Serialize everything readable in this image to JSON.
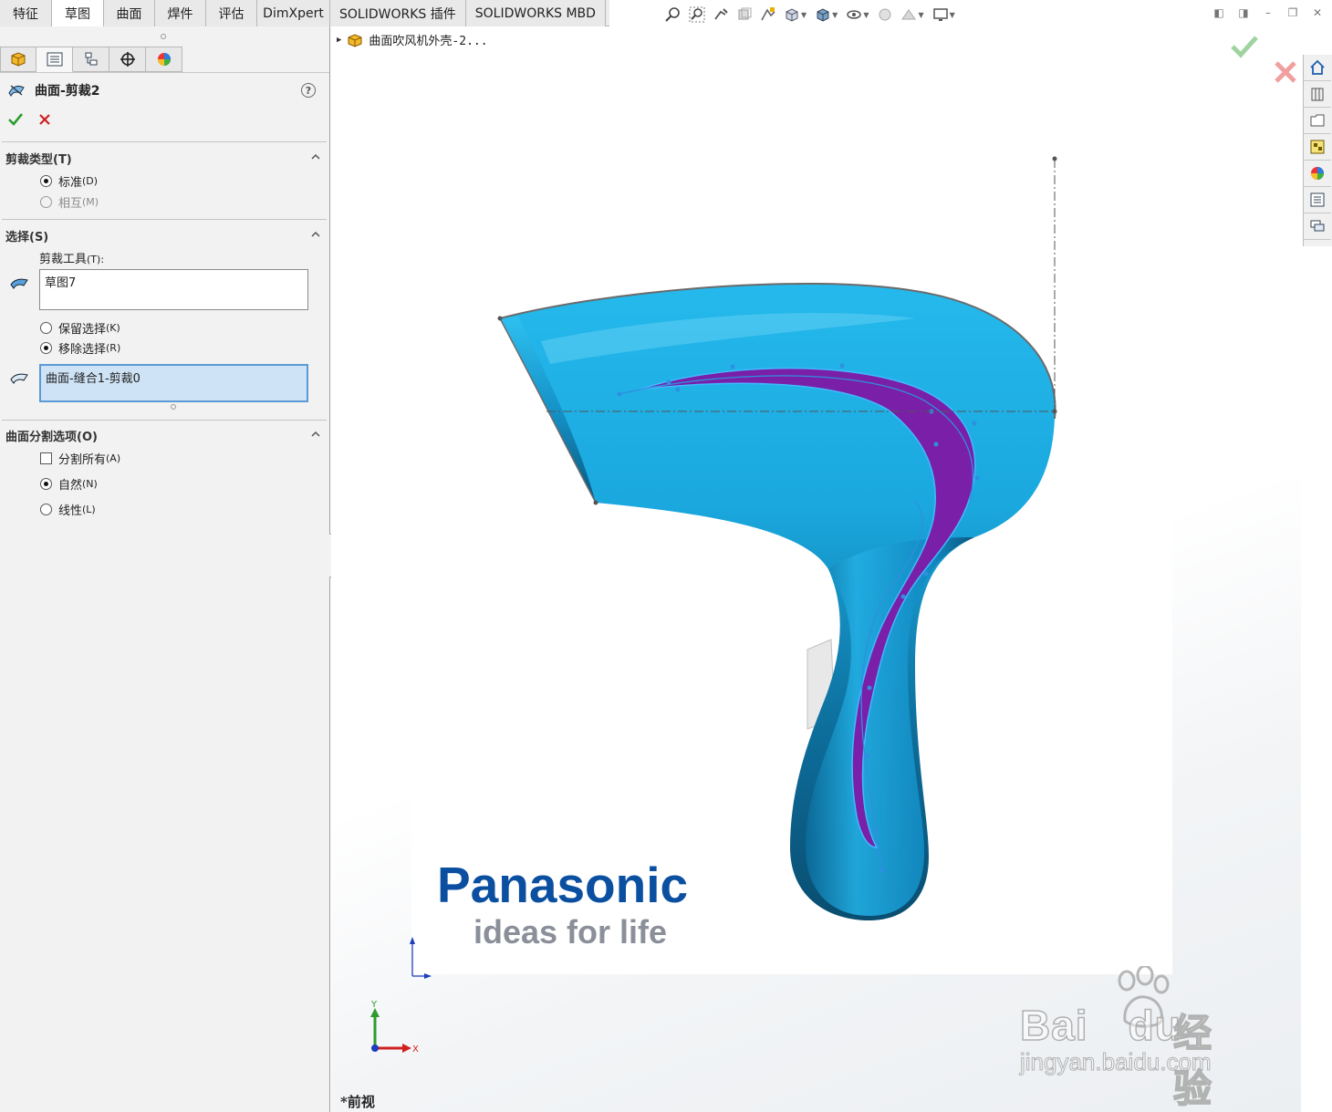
{
  "tabs": [
    {
      "label": "特征",
      "active": false
    },
    {
      "label": "草图",
      "active": true
    },
    {
      "label": "曲面",
      "active": false
    },
    {
      "label": "焊件",
      "active": false
    },
    {
      "label": "评估",
      "active": false
    },
    {
      "label": "DimXpert",
      "active": false
    },
    {
      "label": "SOLIDWORKS 插件",
      "active": false
    },
    {
      "label": "SOLIDWORKS MBD",
      "active": false
    }
  ],
  "panel": {
    "feature_title": "曲面-剪裁2",
    "help": "?",
    "trim_type": {
      "header": "剪裁类型(T)",
      "standard": {
        "label": "标准",
        "mnemonic": "(D)",
        "checked": true
      },
      "mutual": {
        "label": "相互",
        "mnemonic": "(M)",
        "checked": false,
        "enabled": false
      }
    },
    "selections": {
      "header": "选择(S)",
      "trim_tool_label": "剪裁工具",
      "trim_tool_mnemonic": "(T):",
      "trim_tool_value": "草图7",
      "keep": {
        "label": "保留选择",
        "mnemonic": "(K)",
        "checked": false
      },
      "remove": {
        "label": "移除选择",
        "mnemonic": "(R)",
        "checked": true
      },
      "pieces_value": "曲面-缝合1-剪裁0"
    },
    "split_options": {
      "header": "曲面分割选项(O)",
      "split_all": {
        "label": "分割所有",
        "mnemonic": "(A)",
        "checked": false
      },
      "natural": {
        "label": "自然",
        "mnemonic": "(N)",
        "checked": true
      },
      "linear": {
        "label": "线性",
        "mnemonic": "(L)",
        "checked": false
      }
    }
  },
  "viewport": {
    "tree_item": "曲面吹风机外壳-2...",
    "brand_logo": "Panasonic",
    "brand_slogan": "ideas for life",
    "view_name": "*前视",
    "axis_y": "Y",
    "axis_x": "X"
  },
  "watermark": {
    "brand": "Bai",
    "brand2": "du",
    "cn": "经验",
    "url": "jingyan.baidu.com"
  },
  "colors": {
    "accent_blue": "#1aa8de",
    "trim_region": "#7a1fa8",
    "ok_green": "#2e9b2e",
    "cancel_red": "#d02020"
  }
}
